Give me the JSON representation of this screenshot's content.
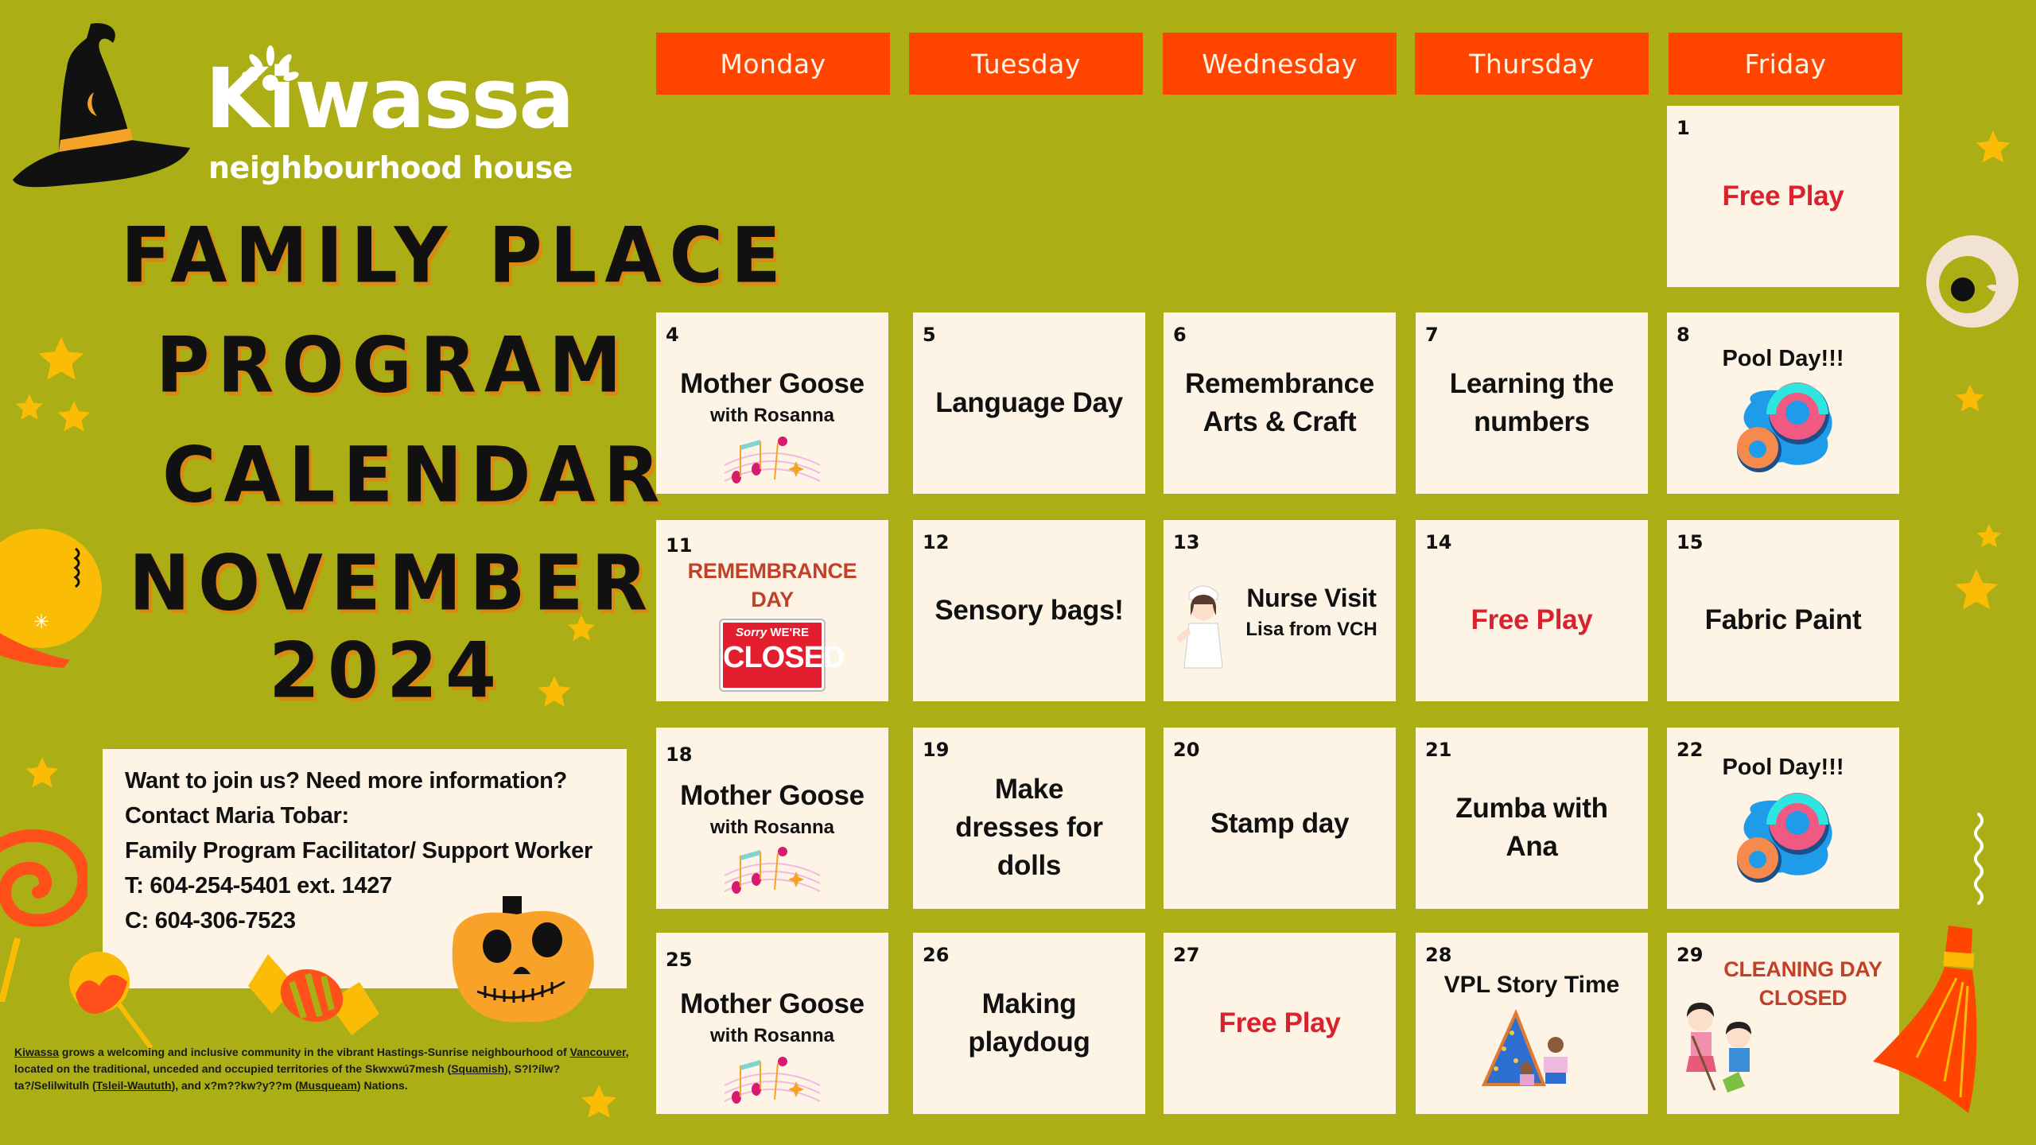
{
  "logo": {
    "name": "Kiwassa",
    "subtitle": "neighbourhood house"
  },
  "title": {
    "lines": [
      "FAMILY PLACE",
      "PROGRAM",
      "CALENDAR",
      "NOVEMBER",
      "2024"
    ]
  },
  "contact": {
    "lines": [
      "Want to join us? Need more information?",
      "Contact Maria Tobar:",
      "Family Program Facilitator/ Support Worker",
      "T: 604-254-5401 ext. 1427",
      "C: 604-306-7523"
    ]
  },
  "footer": {
    "link_kiwassa": "Kiwassa",
    "text1": " grows a welcoming and inclusive community in the vibrant Hastings-Sunrise neighbourhood of ",
    "link_vancouver": "Vancouver",
    "text2": ", located on the traditional, unceded and occupied territories of the Skwxwú7mesh (",
    "link_squamish": "Squamish",
    "text3": "), S?l?ílw?ta?/Selilwitulh (",
    "link_tsleil": "Tsleil-Waututh",
    "text4": "), and x?m??kw?y??m (",
    "link_musqueam": "Musqueam",
    "text5": ") Nations."
  },
  "colors": {
    "background": "#ABAE15",
    "header": "#FF4500",
    "cell": "#FDF4E5",
    "free_play": "#D8232F",
    "closed_text": "#C1402A"
  },
  "calendar": {
    "weekdays": [
      "Monday",
      "Tuesday",
      "Wednesday",
      "Thursday",
      "Friday"
    ],
    "days": {
      "d1": {
        "date": "1",
        "title": "Free Play"
      },
      "d4": {
        "date": "4",
        "title": "Mother Goose",
        "sub": "with Rosanna",
        "icon": "music-notes-icon"
      },
      "d5": {
        "date": "5",
        "title": "Language Day"
      },
      "d6": {
        "date": "6",
        "title": "Remembrance Arts & Craft"
      },
      "d7": {
        "date": "7",
        "title": "Learning the numbers"
      },
      "d8": {
        "date": "8",
        "title": "Pool Day!!!",
        "icon": "swim-rings-icon"
      },
      "d11": {
        "date": "11",
        "title": "REMEMBRANCE DAY",
        "sign_top": "Sorry",
        "sign_top2": "WE'RE",
        "sign_main": "CLOSED"
      },
      "d12": {
        "date": "12",
        "title": "Sensory bags!"
      },
      "d13": {
        "date": "13",
        "title": "Nurse Visit",
        "sub": "Lisa from VCH",
        "icon": "nurse-icon"
      },
      "d14": {
        "date": "14",
        "title": "Free Play"
      },
      "d15": {
        "date": "15",
        "title": "Fabric Paint"
      },
      "d18": {
        "date": "18",
        "title": "Mother Goose",
        "sub": "with Rosanna",
        "icon": "music-notes-icon"
      },
      "d19": {
        "date": "19",
        "title": "Make dresses for dolls"
      },
      "d20": {
        "date": "20",
        "title": "Stamp day"
      },
      "d21": {
        "date": "21",
        "title": "Zumba with Ana"
      },
      "d22": {
        "date": "22",
        "title": "Pool Day!!!",
        "icon": "swim-rings-icon"
      },
      "d25": {
        "date": "25",
        "title": "Mother Goose",
        "sub": "with Rosanna",
        "icon": "music-notes-icon"
      },
      "d26": {
        "date": "26",
        "title": "Making playdoug"
      },
      "d27": {
        "date": "27",
        "title": "Free Play"
      },
      "d28": {
        "date": "28",
        "title": "VPL Story Time",
        "icon": "story-tent-icon"
      },
      "d29": {
        "date": "29",
        "title": "CLEANING DAY CLOSED",
        "icon": "kids-cleaning-icon"
      }
    }
  }
}
